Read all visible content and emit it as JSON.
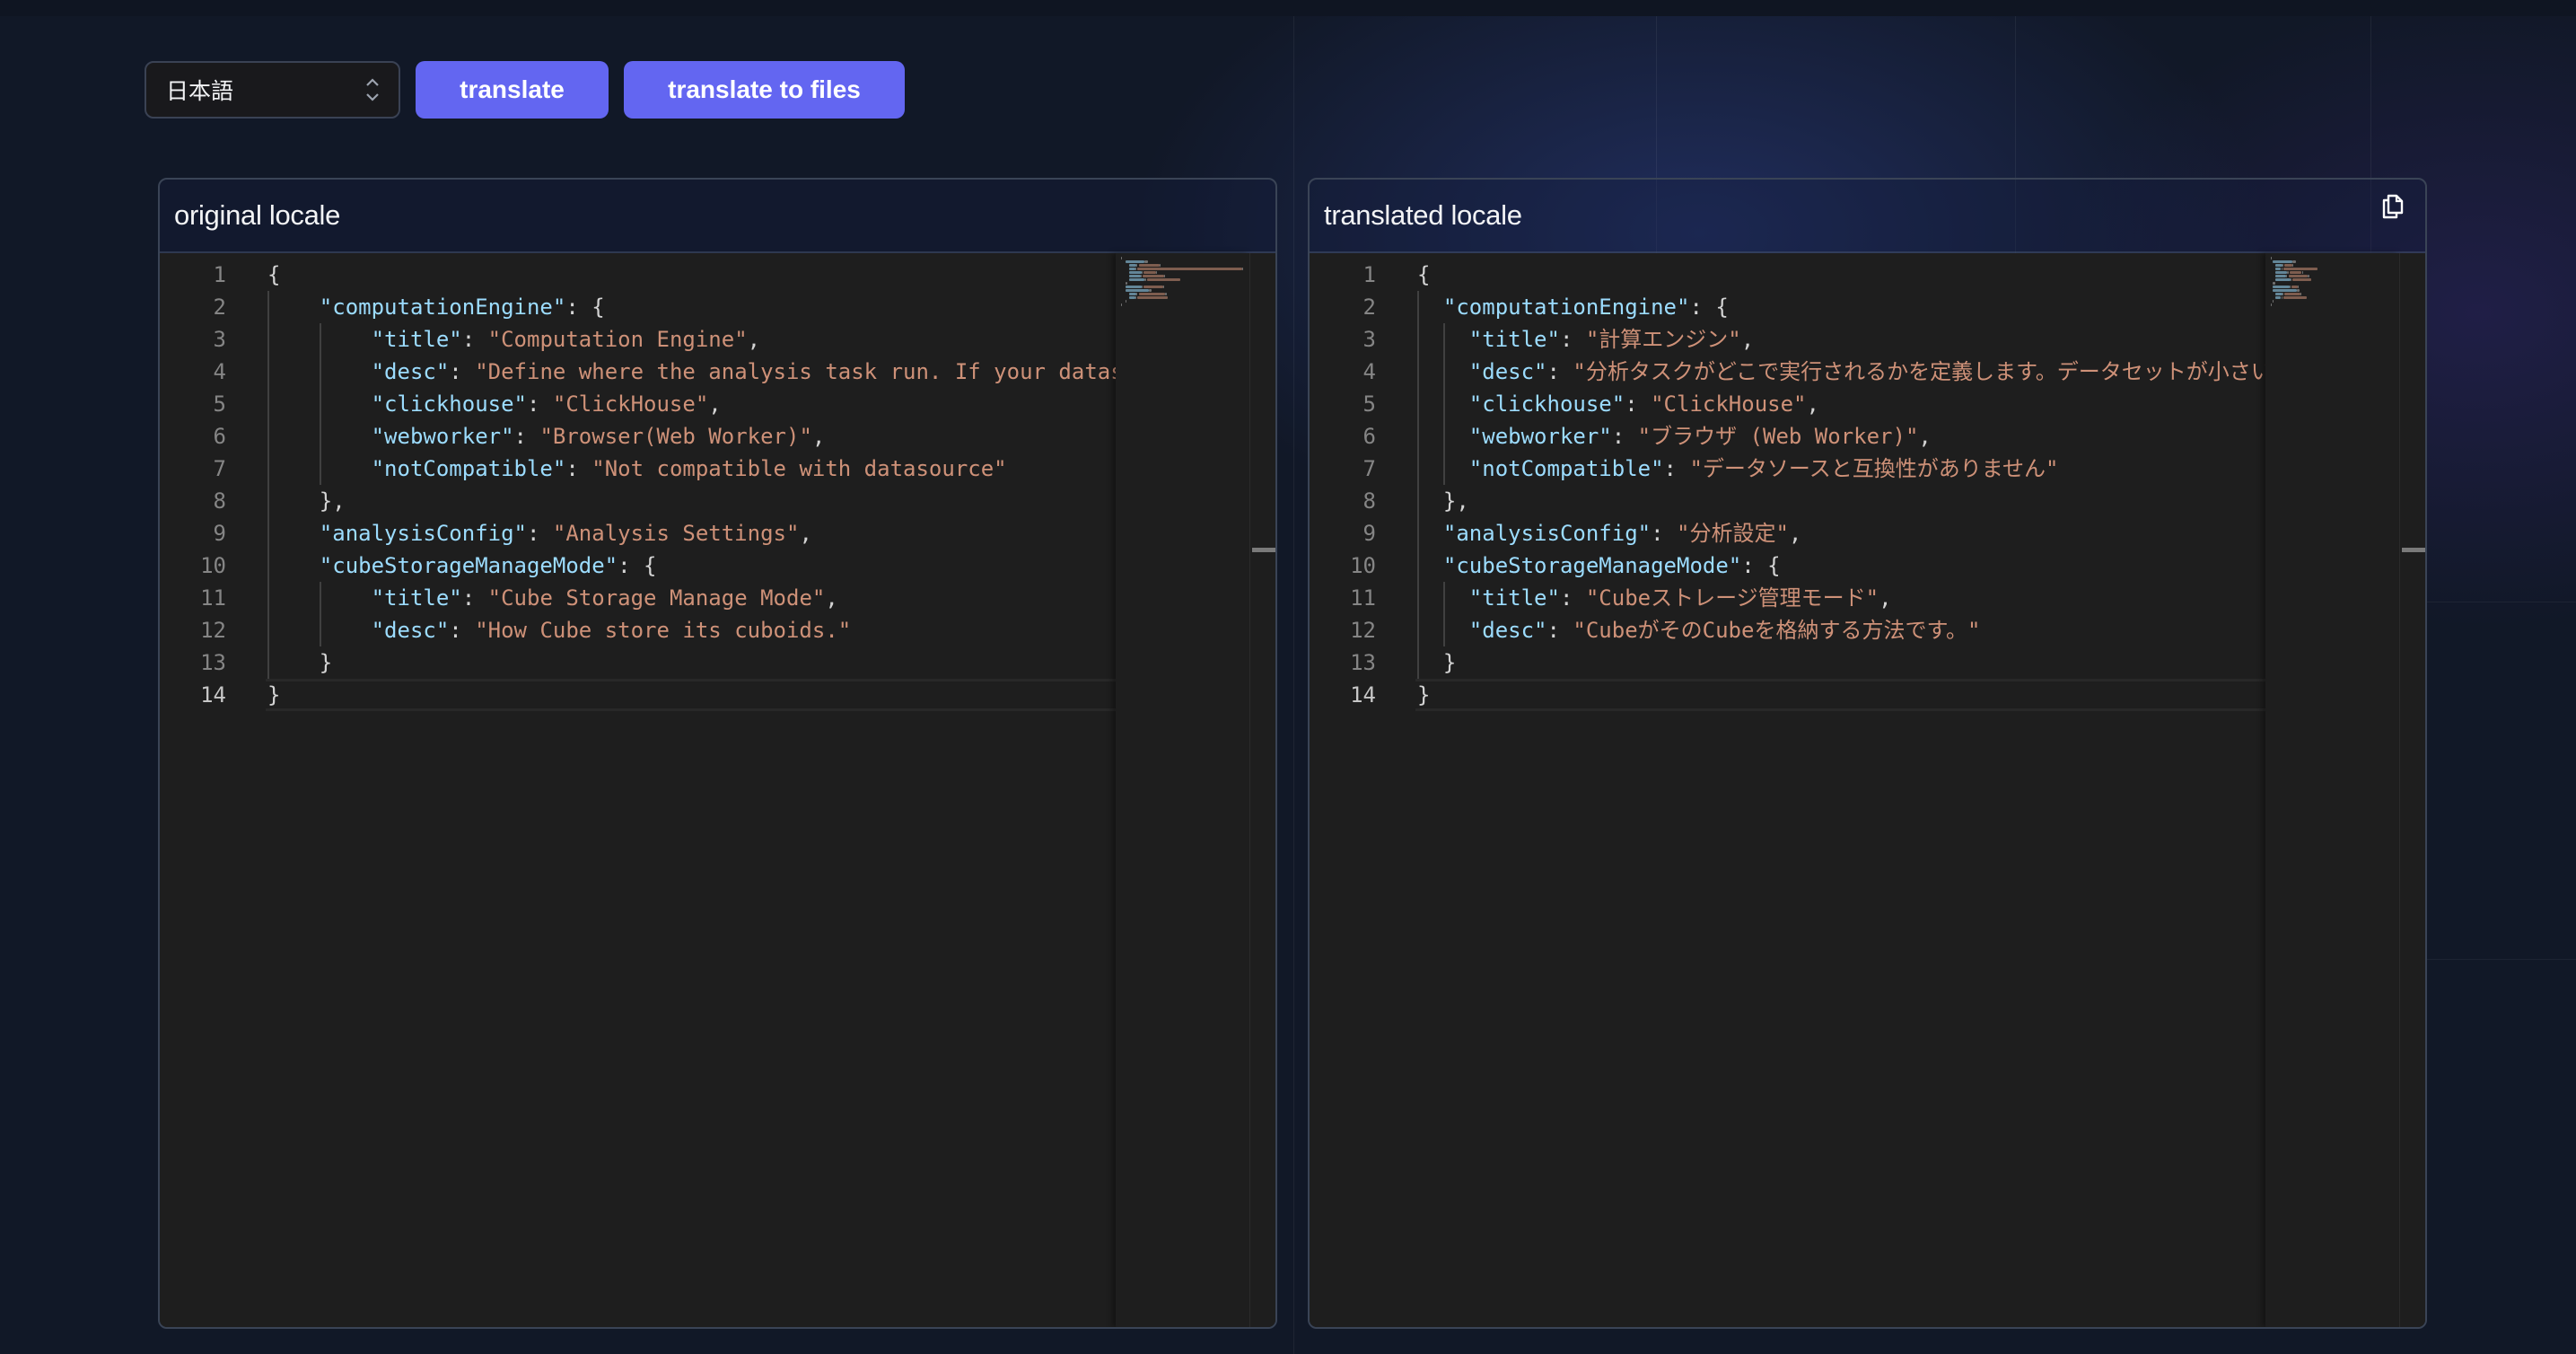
{
  "toolbar": {
    "language_select": {
      "value": "日本語"
    },
    "translate_label": "translate",
    "translate_files_label": "translate to files"
  },
  "panels": {
    "original": {
      "title": "original locale",
      "lines": [
        [
          [
            "p",
            "{"
          ]
        ],
        [
          [
            "p",
            "    "
          ],
          [
            "k",
            "\"computationEngine\""
          ],
          [
            "p",
            ": {"
          ]
        ],
        [
          [
            "p",
            "        "
          ],
          [
            "k",
            "\"title\""
          ],
          [
            "p",
            ": "
          ],
          [
            "s",
            "\"Computation Engine\""
          ],
          [
            "p",
            ","
          ]
        ],
        [
          [
            "p",
            "        "
          ],
          [
            "k",
            "\"desc\""
          ],
          [
            "p",
            ": "
          ],
          [
            "s",
            "\"Define where the analysis task run. If your dataset is small, use Web Worker; otherwise ClickHouse.\""
          ],
          [
            "p",
            ","
          ]
        ],
        [
          [
            "p",
            "        "
          ],
          [
            "k",
            "\"clickhouse\""
          ],
          [
            "p",
            ": "
          ],
          [
            "s",
            "\"ClickHouse\""
          ],
          [
            "p",
            ","
          ]
        ],
        [
          [
            "p",
            "        "
          ],
          [
            "k",
            "\"webworker\""
          ],
          [
            "p",
            ": "
          ],
          [
            "s",
            "\"Browser(Web Worker)\""
          ],
          [
            "p",
            ","
          ]
        ],
        [
          [
            "p",
            "        "
          ],
          [
            "k",
            "\"notCompatible\""
          ],
          [
            "p",
            ": "
          ],
          [
            "s",
            "\"Not compatible with datasource\""
          ]
        ],
        [
          [
            "p",
            "    },"
          ]
        ],
        [
          [
            "p",
            "    "
          ],
          [
            "k",
            "\"analysisConfig\""
          ],
          [
            "p",
            ": "
          ],
          [
            "s",
            "\"Analysis Settings\""
          ],
          [
            "p",
            ","
          ]
        ],
        [
          [
            "p",
            "    "
          ],
          [
            "k",
            "\"cubeStorageManageMode\""
          ],
          [
            "p",
            ": {"
          ]
        ],
        [
          [
            "p",
            "        "
          ],
          [
            "k",
            "\"title\""
          ],
          [
            "p",
            ": "
          ],
          [
            "s",
            "\"Cube Storage Manage Mode\""
          ],
          [
            "p",
            ","
          ]
        ],
        [
          [
            "p",
            "        "
          ],
          [
            "k",
            "\"desc\""
          ],
          [
            "p",
            ": "
          ],
          [
            "s",
            "\"How Cube store its cuboids.\""
          ]
        ],
        [
          [
            "p",
            "    }"
          ]
        ],
        [
          [
            "p",
            "}"
          ]
        ]
      ],
      "visible_desc_text": "\"Define where the analysis task run. If your datas"
    },
    "translated": {
      "title": "translated locale",
      "copy_icon": "copy-icon",
      "lines": [
        [
          [
            "p",
            "{"
          ]
        ],
        [
          [
            "p",
            "  "
          ],
          [
            "k",
            "\"computationEngine\""
          ],
          [
            "p",
            ": {"
          ]
        ],
        [
          [
            "p",
            "    "
          ],
          [
            "k",
            "\"title\""
          ],
          [
            "p",
            ": "
          ],
          [
            "s",
            "\"計算エンジン\""
          ],
          [
            "p",
            ","
          ]
        ],
        [
          [
            "p",
            "    "
          ],
          [
            "k",
            "\"desc\""
          ],
          [
            "p",
            ": "
          ],
          [
            "s",
            "\"分析タスクがどこで実行されるかを定義します。データセットが小さい"
          ]
        ],
        [
          [
            "p",
            "    "
          ],
          [
            "k",
            "\"clickhouse\""
          ],
          [
            "p",
            ": "
          ],
          [
            "s",
            "\"ClickHouse\""
          ],
          [
            "p",
            ","
          ]
        ],
        [
          [
            "p",
            "    "
          ],
          [
            "k",
            "\"webworker\""
          ],
          [
            "p",
            ": "
          ],
          [
            "s",
            "\"ブラウザ (Web Worker)\""
          ],
          [
            "p",
            ","
          ]
        ],
        [
          [
            "p",
            "    "
          ],
          [
            "k",
            "\"notCompatible\""
          ],
          [
            "p",
            ": "
          ],
          [
            "s",
            "\"データソースと互換性がありません\""
          ]
        ],
        [
          [
            "p",
            "  },"
          ]
        ],
        [
          [
            "p",
            "  "
          ],
          [
            "k",
            "\"analysisConfig\""
          ],
          [
            "p",
            ": "
          ],
          [
            "s",
            "\"分析設定\""
          ],
          [
            "p",
            ","
          ]
        ],
        [
          [
            "p",
            "  "
          ],
          [
            "k",
            "\"cubeStorageManageMode\""
          ],
          [
            "p",
            ": {"
          ]
        ],
        [
          [
            "p",
            "    "
          ],
          [
            "k",
            "\"title\""
          ],
          [
            "p",
            ": "
          ],
          [
            "s",
            "\"Cubeストレージ管理モード\""
          ],
          [
            "p",
            ","
          ]
        ],
        [
          [
            "p",
            "    "
          ],
          [
            "k",
            "\"desc\""
          ],
          [
            "p",
            ": "
          ],
          [
            "s",
            "\"CubeがそのCubeを格納する方法です。\""
          ]
        ],
        [
          [
            "p",
            "  }"
          ]
        ],
        [
          [
            "p",
            "}"
          ]
        ]
      ]
    }
  },
  "active_line": 14,
  "colors": {
    "accent": "#6366f1",
    "editor_bg": "#1e1e1e",
    "json_key": "#9cdcfe",
    "json_string": "#ce9178",
    "punctuation": "#d4d4d4",
    "line_number": "#858585"
  }
}
